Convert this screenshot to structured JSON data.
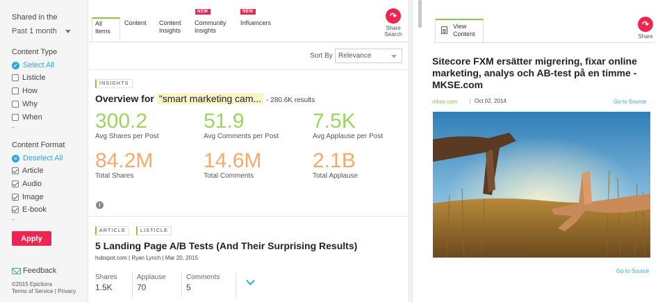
{
  "sidebar": {
    "shared_in_label": "Shared in the",
    "period_value": "Past 1 month",
    "content_type_label": "Content Type",
    "content_type_options": [
      {
        "label": "Select All",
        "checked": true,
        "style": "select-all"
      },
      {
        "label": "Listicle",
        "checked": false
      },
      {
        "label": "How",
        "checked": false
      },
      {
        "label": "Why",
        "checked": false
      },
      {
        "label": "When",
        "checked": false
      }
    ],
    "content_format_label": "Content Format",
    "content_format_options": [
      {
        "label": "Deselect All",
        "checked": true,
        "style": "deselect-all"
      },
      {
        "label": "Article",
        "checked": true
      },
      {
        "label": "Audio",
        "checked": true
      },
      {
        "label": "Image",
        "checked": true
      },
      {
        "label": "E-book",
        "checked": true
      }
    ],
    "apply_label": "Apply",
    "feedback_label": "Feedback",
    "copyright": "©2015 Epictions",
    "terms": "Terms of Service | Privacy"
  },
  "tabs": [
    {
      "label": "All Items",
      "active": true,
      "new": false
    },
    {
      "label": "Content",
      "active": false,
      "new": false
    },
    {
      "label": "Content Insights",
      "active": false,
      "new": false
    },
    {
      "label": "Community Insights",
      "active": false,
      "new": true
    },
    {
      "label": "Influencers",
      "active": false,
      "new": true
    }
  ],
  "new_badge": "NEW",
  "share_search": "Share Search",
  "sort": {
    "label": "Sort By",
    "value": "Relevance"
  },
  "insights": {
    "tag": "INSIGHTS",
    "title_prefix": "Overview for",
    "query": "\"smart marketing cam...",
    "results": "- 280.6K results",
    "stats": [
      {
        "value": "300.2",
        "label": "Avg Shares per Post",
        "color": "green"
      },
      {
        "value": "51.9",
        "label": "Avg Comments per Post",
        "color": "green"
      },
      {
        "value": "7.5K",
        "label": "Avg Applause per Post",
        "color": "green"
      },
      {
        "value": "84.2M",
        "label": "Total Shares",
        "color": "orange"
      },
      {
        "value": "14.6M",
        "label": "Total Comments",
        "color": "orange"
      },
      {
        "value": "2.1B",
        "label": "Total Applause",
        "color": "orange"
      }
    ]
  },
  "article": {
    "tags": [
      "ARTICLE",
      "LISTICLE"
    ],
    "title": "5 Landing Page A/B Tests (And Their Surprising Results)",
    "meta": "hubspot.com | Ryan Lynch | Mar 20, 2015",
    "metrics": [
      {
        "label": "Shares",
        "value": "1.5K"
      },
      {
        "label": "Applause",
        "value": "70"
      },
      {
        "label": "Comments",
        "value": "5"
      }
    ]
  },
  "viewer": {
    "tab_label": "View Content",
    "share_label": "Share",
    "title": "Sitecore FXM ersätter migrering, fixar online marketing, analys och AB-test på en timme - MKSE.com",
    "source": "mkse.com",
    "date": "Oct 02, 2014",
    "go_to_source": "Go to Source"
  },
  "colors": {
    "accent_red": "#ee2451",
    "accent_green": "#8dc63f",
    "link_blue": "#29a8e0",
    "stat_green": "#9ad75b",
    "stat_orange": "#f8a86a"
  }
}
